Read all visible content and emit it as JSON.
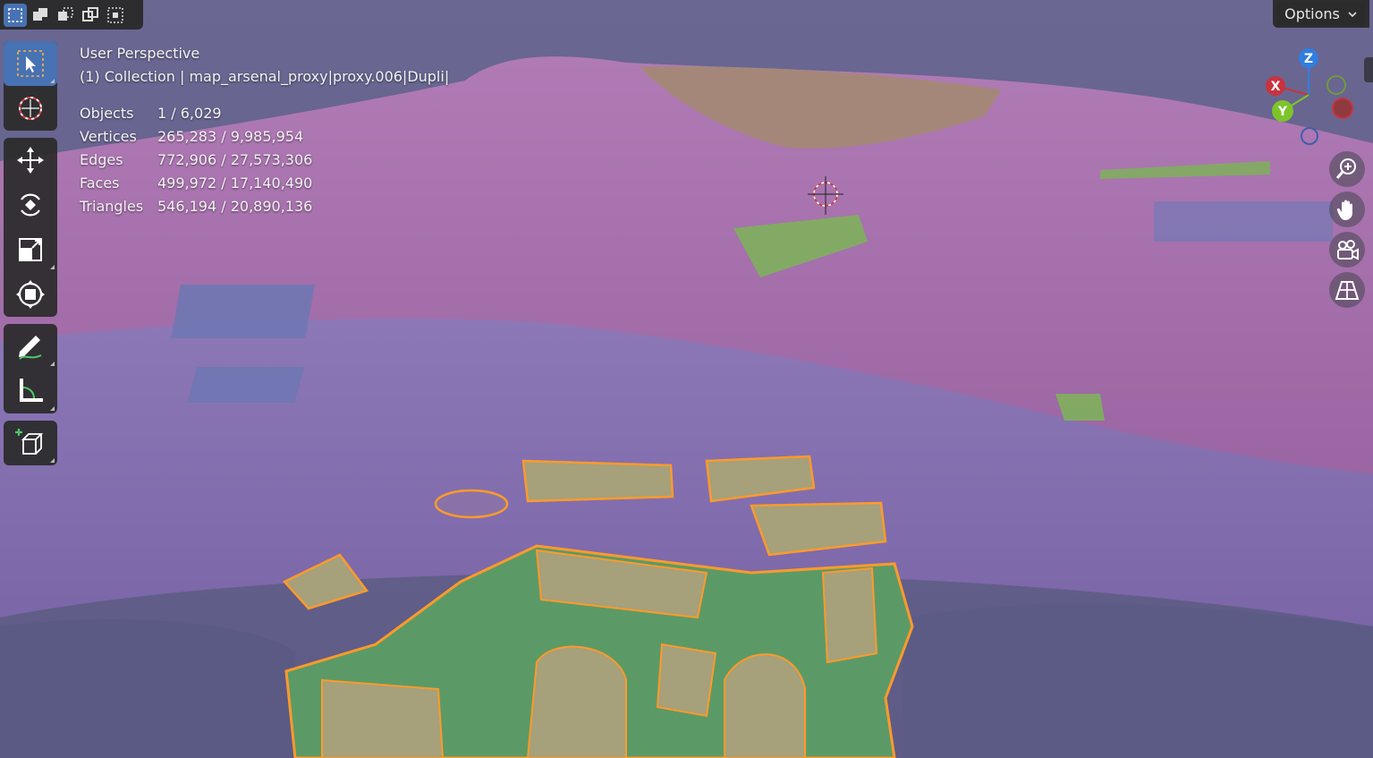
{
  "header": {
    "select_modes": [
      "select-new-icon",
      "select-extend-icon",
      "select-subtract-icon",
      "select-invert-icon",
      "select-intersect-icon"
    ],
    "options_label": "Options"
  },
  "toolbar": {
    "tools": [
      "select-box-icon",
      "cursor-icon",
      "move-icon",
      "rotate-icon",
      "scale-icon",
      "transform-icon",
      "annotate-icon",
      "measure-icon",
      "add-cube-icon"
    ]
  },
  "viewport": {
    "view_name": "User Perspective",
    "collection_path": "(1) Collection | map_arsenal_proxy|proxy.006|Dupli|",
    "stats": [
      {
        "label": "Objects",
        "value": "1 / 6,029"
      },
      {
        "label": "Vertices",
        "value": "265,283 / 9,985,954"
      },
      {
        "label": "Edges",
        "value": "772,906 / 27,573,306"
      },
      {
        "label": "Faces",
        "value": "499,972 / 17,140,490"
      },
      {
        "label": "Triangles",
        "value": "546,194 / 20,890,136"
      }
    ]
  },
  "gizmo": {
    "axes": {
      "z": "Z",
      "x": "X",
      "y": "Y"
    },
    "colors": {
      "x": "#c8333f",
      "y": "#7dc42a",
      "z": "#2f7ee0"
    }
  },
  "navigation": [
    "zoom-icon",
    "pan-hand-icon",
    "camera-icon",
    "perspective-grid-icon"
  ],
  "colors": {
    "terrain_pink": "#a06aa7",
    "terrain_purple": "#8470ad",
    "water": "#5e5b86",
    "selected_outline": "#ff9a2a",
    "selected_fill": "#4f9a6a",
    "buildings": "#a6a07b",
    "active_tool": "#4772b3"
  }
}
